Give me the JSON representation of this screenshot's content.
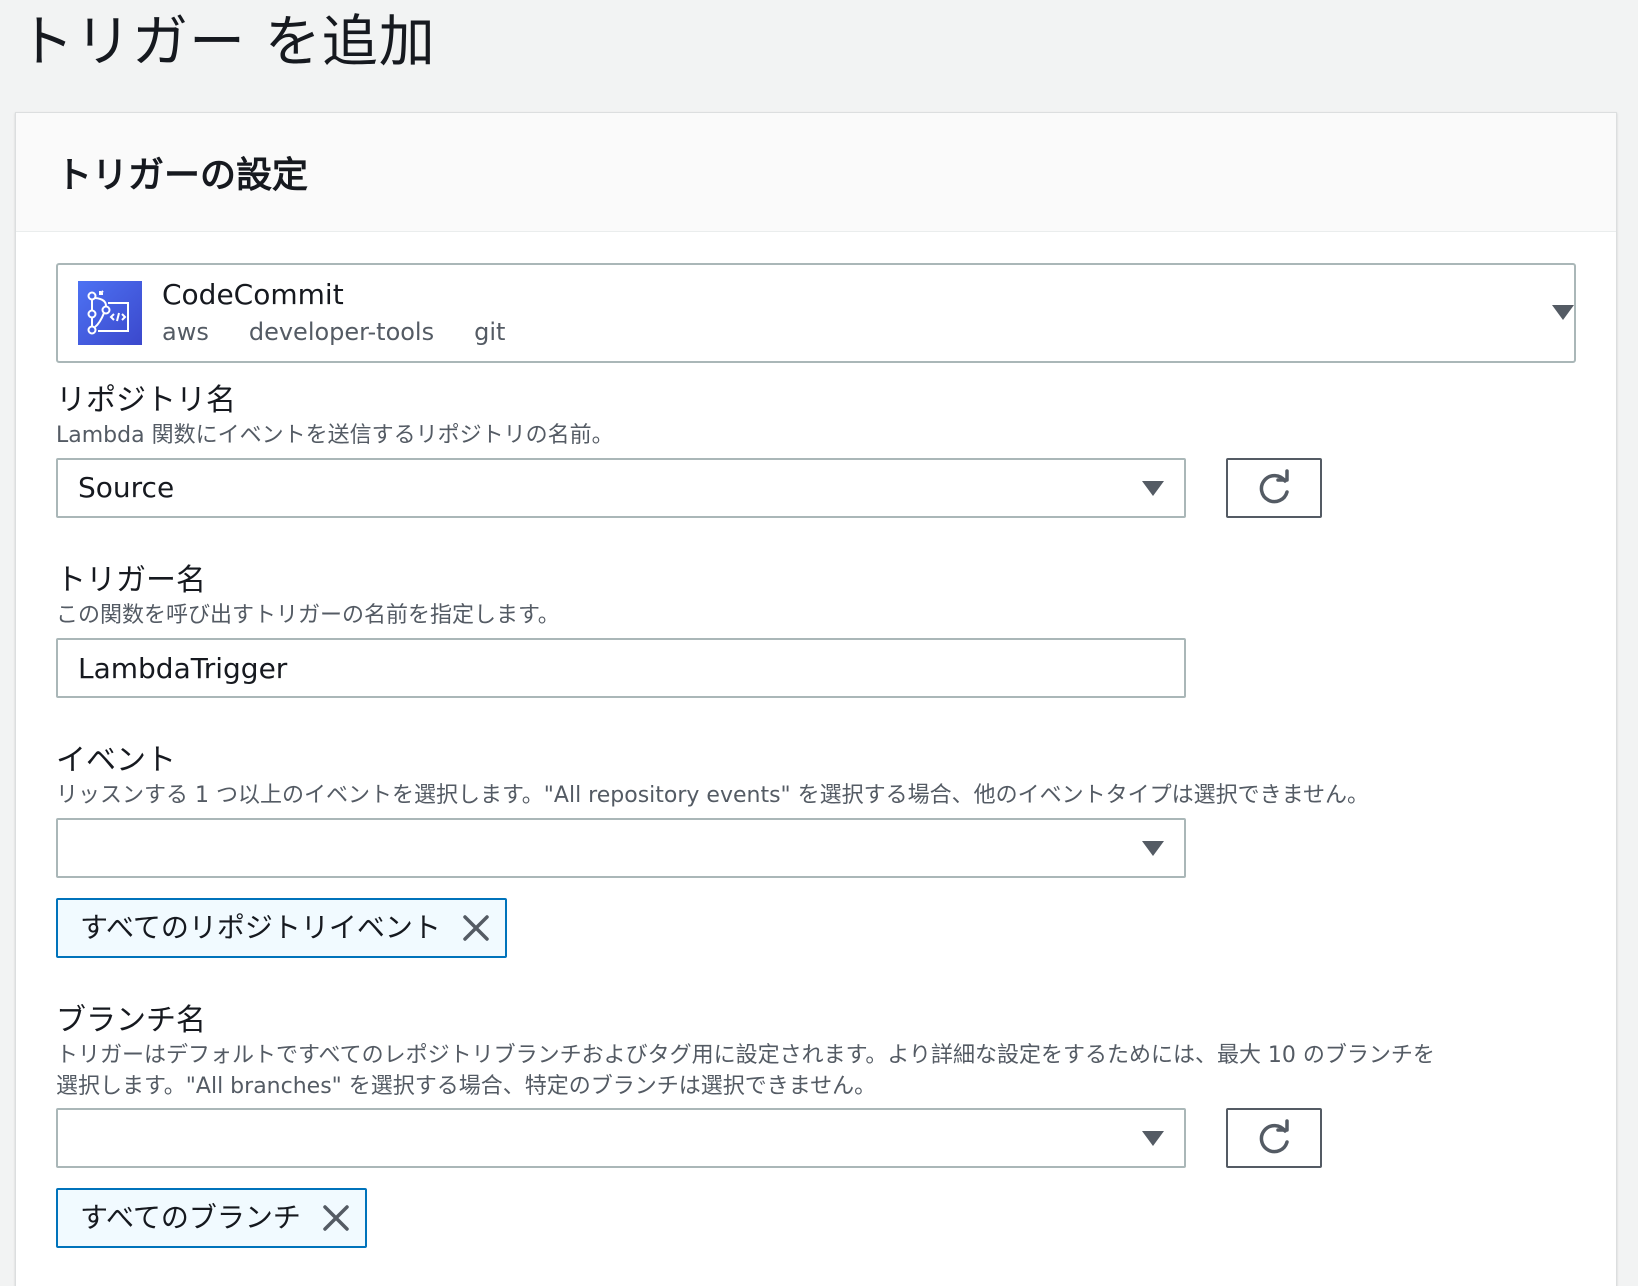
{
  "page": {
    "title": "トリガー を追加"
  },
  "panel": {
    "title": "トリガーの設定"
  },
  "source": {
    "name": "CodeCommit",
    "tags": [
      "aws",
      "developer-tools",
      "git"
    ],
    "icon": "codecommit-icon",
    "icon_color": "#3b48cc"
  },
  "repository": {
    "label": "リポジトリ名",
    "description": "Lambda 関数にイベントを送信するリポジトリの名前。",
    "value": "Source"
  },
  "trigger": {
    "label": "トリガー名",
    "description": "この関数を呼び出すトリガーの名前を指定します。",
    "value": "LambdaTrigger"
  },
  "events": {
    "label": "イベント",
    "description": "リッスンする 1 つ以上のイベントを選択します。\"All repository events\" を選択する場合、他のイベントタイプは選択できません。",
    "value": "",
    "token": "すべてのリポジトリイベント"
  },
  "branches": {
    "label": "ブランチ名",
    "description_line1": "トリガーはデフォルトですべてのレポジトリブランチおよびタグ用に設定されます。より詳細な設定をするためには、最大 10 のブランチを",
    "description_line2": "選択します。\"All branches\" を選択する場合、特定のブランチは選択できません。",
    "value": "",
    "token": "すべてのブランチ"
  },
  "colors": {
    "token_border": "#0073bb",
    "token_bg": "#f1faff",
    "input_border": "#aab7b8"
  }
}
